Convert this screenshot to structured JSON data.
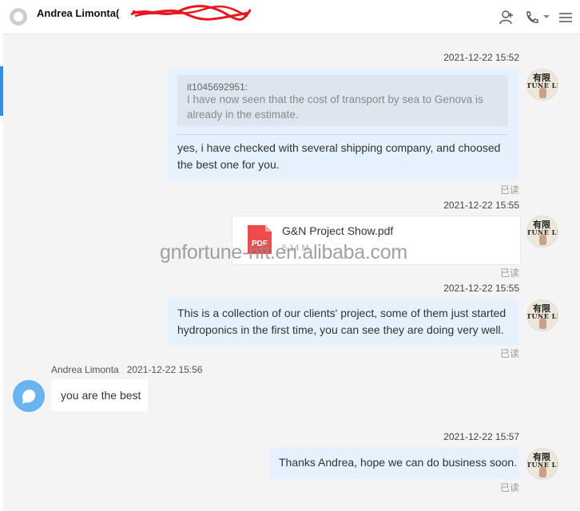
{
  "header": {
    "contact_title": "Andrea Limonta(",
    "icons": [
      "contact-add-icon",
      "phone-icon",
      "caret-down-icon",
      "menu-icon"
    ]
  },
  "messages": [
    {
      "time": "2021-12-22 15:52",
      "quote_author": "it1045692951:",
      "quote_text": "I have now seen that the cost of transport by sea to Genova is already in the estimate.",
      "text": "yes, i have checked with several shipping company, and choosed the best one for you.",
      "status": "已读"
    },
    {
      "time": "2021-12-22 15:55",
      "file_icon_label": "PDF",
      "file_name": "G&N Project Show.pdf",
      "file_size": "5.14 M",
      "status": "已读"
    },
    {
      "time": "2021-12-22 15:55",
      "text": "This is a collection of our clients' project, some of them just started hydroponics in the first time, you can see they are doing very well.",
      "status": "已读"
    },
    {
      "sender": "Andrea Limonta",
      "time": "2021-12-22 15:56",
      "text": "you are the best"
    },
    {
      "time": "2021-12-22 15:57",
      "text": "Thanks Andrea, hope we can do business soon.",
      "status": "已读"
    }
  ],
  "my_avatar": {
    "line1": "有限",
    "line2": "TUNE LIN"
  },
  "watermark": "gnfortune-hft.en.alibaba.com",
  "colors": {
    "my_bubble": "#e5f1fd",
    "their_bubble": "#ffffff",
    "pdf_red": "#f04a4a",
    "accent_blue": "#2d8cf0",
    "redaction_red": "#e8161f"
  }
}
